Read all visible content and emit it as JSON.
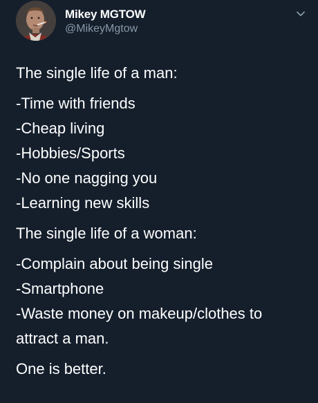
{
  "user": {
    "display_name": "Mikey MGTOW",
    "handle": "@MikeyMgtow"
  },
  "icons": {
    "avatar": "profile-photo",
    "menu": "chevron-down-icon"
  },
  "colors": {
    "background": "#151f2c",
    "text": "#ffffff",
    "secondary_text": "#8899a6"
  },
  "tweet": {
    "man_heading": "The single life of a man:",
    "man_items": [
      "-Time with friends",
      "-Cheap living",
      "-Hobbies/Sports",
      "-No one nagging you",
      "-Learning new skills"
    ],
    "woman_heading": "The single life of a woman:",
    "woman_items": [
      "-Complain about being single",
      "-Smartphone",
      "-Waste money on makeup/clothes to attract a man."
    ],
    "closing": "One is better."
  }
}
